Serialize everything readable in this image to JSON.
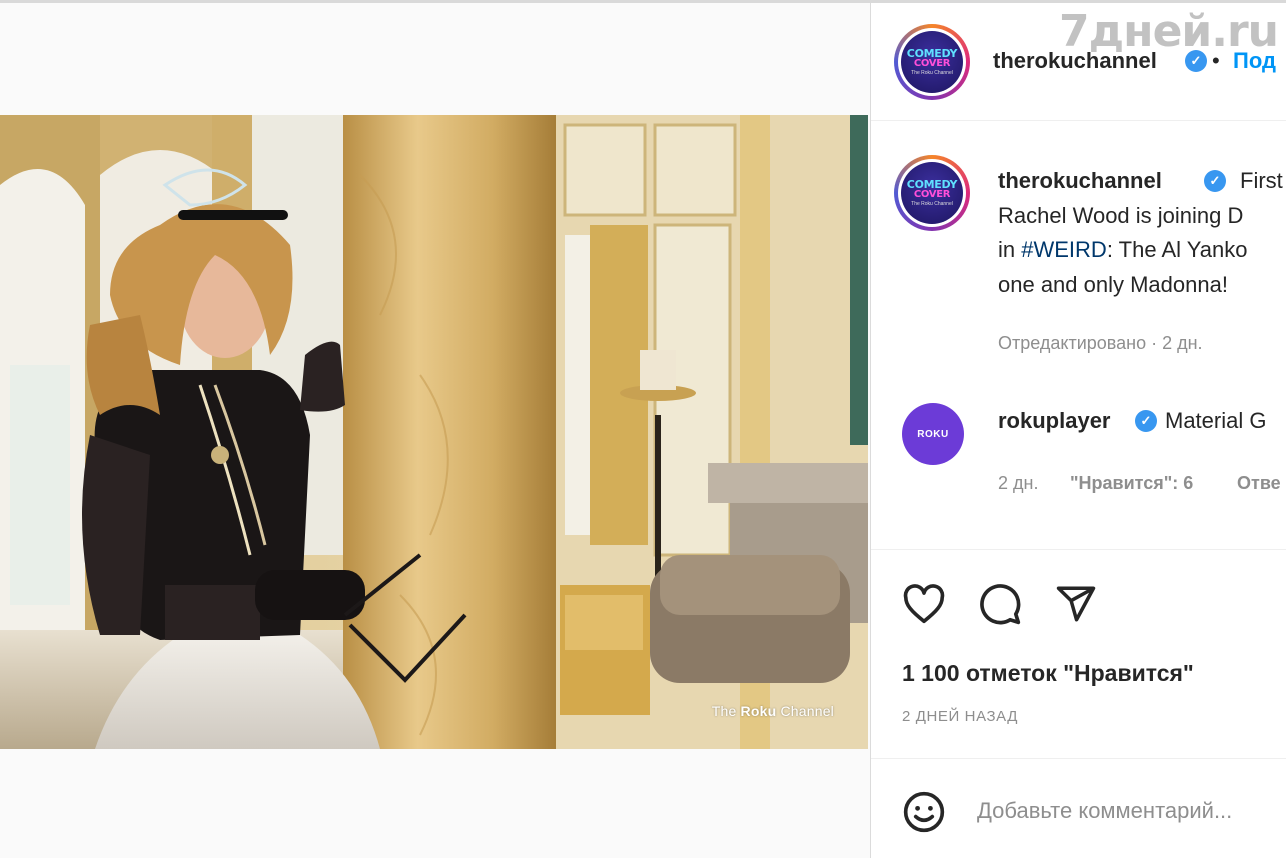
{
  "post": {
    "image_watermark": {
      "prefix": "The",
      "brand": "Roku",
      "suffix": "Channel"
    },
    "author": {
      "username": "therokuchannel",
      "avatar_text": [
        "COMEDY",
        "COVER",
        "The Roku Channel"
      ],
      "follow_label": "Под"
    },
    "caption": {
      "username": "therokuchannel",
      "lines": [
        "First l",
        "Rachel Wood is joining D",
        "The Al Yanko",
        "one and only Madonna!"
      ],
      "hashtag": "#WEIRD",
      "line3_prefix": "in ",
      "line3_suffix": ": The Al Yanko",
      "meta": "Отредактировано · 2 дн."
    },
    "comments": [
      {
        "username": "rokuplayer",
        "avatar_text": "ROKU",
        "text": "Material G",
        "time": "2 дн.",
        "likes": "\"Нравится\": 6",
        "reply": "Отве"
      }
    ],
    "likes_count": "1 100 отметок \"Нравится\"",
    "time_ago": "2 дней назад",
    "comment_placeholder": "Добавьте комментарий..."
  },
  "site_logo": "7дней.ru",
  "colors": {
    "accent": "#0095f6",
    "verified": "#3897f0",
    "hashtag": "#00376b",
    "gray": "#8e8e8e"
  },
  "icons": [
    "heart-icon",
    "comment-icon",
    "share-icon",
    "emoji-icon",
    "verified-badge-icon"
  ]
}
